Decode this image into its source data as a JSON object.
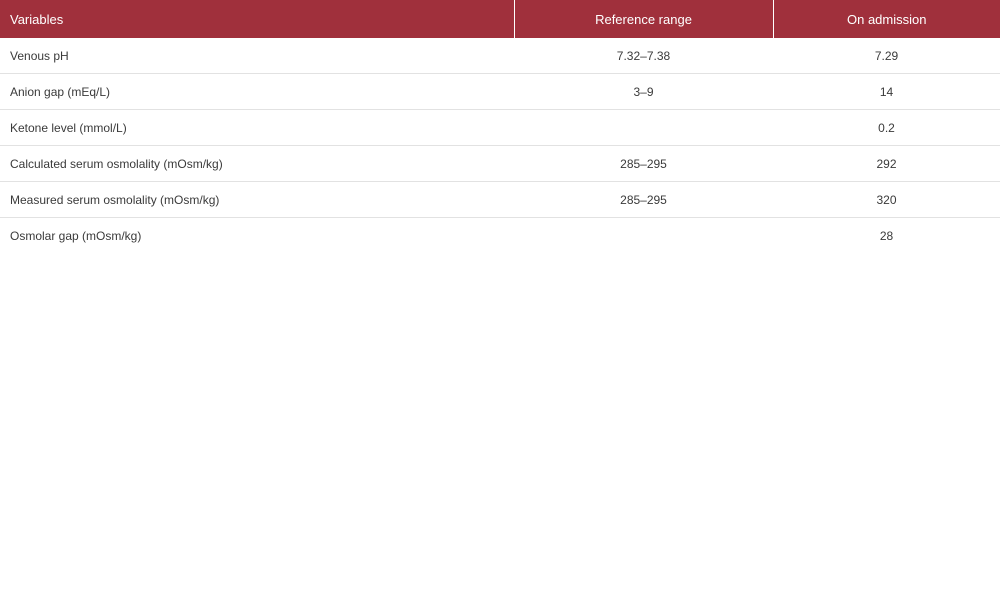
{
  "table": {
    "headers": [
      "Variables",
      "Reference range",
      "On admission"
    ],
    "rows": [
      [
        "Venous pH",
        "7.32–7.38",
        "7.29"
      ],
      [
        "Anion gap (mEq/L)",
        "3–9",
        "14"
      ],
      [
        "Ketone level (mmol/L)",
        "",
        "0.2"
      ],
      [
        "Calculated serum osmolality (mOsm/kg)",
        "285–295",
        "292"
      ],
      [
        "Measured serum osmolality (mOsm/kg)",
        "285–295",
        "320"
      ],
      [
        "Osmolar gap (mOsm/kg)",
        "",
        "28"
      ]
    ]
  },
  "colors": {
    "header_background": "#a0303c",
    "header_text": "#ffffff",
    "row_divider": "#e2e2e2"
  }
}
